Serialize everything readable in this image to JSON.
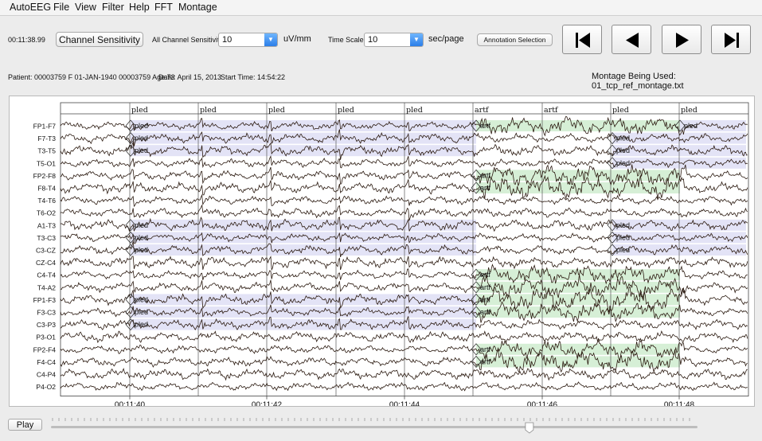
{
  "menu": [
    "AutoEEG",
    "File",
    "View",
    "Filter",
    "Help",
    "FFT",
    "Montage"
  ],
  "toolbar": {
    "clock": "00:11:38.99",
    "channel_sensitivity_button": "Channel Sensitivity",
    "all_channel_sensitivity_label": "All Channel Sensitivity",
    "sensitivity_value": "10",
    "sensitivity_unit": "uV/mm",
    "time_scale_label": "Time Scale",
    "time_scale_value": "10",
    "time_scale_unit": "sec/page",
    "annotation_button": "Annotation Selection",
    "nav_icons": [
      "skip-to-start-icon",
      "previous-icon",
      "next-icon",
      "skip-to-end-icon"
    ]
  },
  "info": {
    "patient": "Patient: 00003759 F 01-JAN-1940 00003759 Age:73",
    "date": "Date: April 15, 2013",
    "start_time": "Start Time: 14:54:22",
    "montage": "Montage Being Used: 01_tcp_ref_montage.txt"
  },
  "channels": [
    "FP1-F7",
    "F7-T3",
    "T3-T5",
    "T5-O1",
    "FP2-F8",
    "F8-T4",
    "T4-T6",
    "T6-O2",
    "A1-T3",
    "T3-C3",
    "C3-CZ",
    "CZ-C4",
    "C4-T4",
    "T4-A2",
    "FP1-F3",
    "F3-C3",
    "C3-P3",
    "P3-O1",
    "FP2-F4",
    "F4-C4",
    "C4-P4",
    "P4-O2"
  ],
  "time_labels": [
    "00:11:40",
    "00:11:42",
    "00:11:44",
    "00:11:46",
    "00:11:48"
  ],
  "top_markers": [
    "pled",
    "pled",
    "pled",
    "pled",
    "pled",
    "artf",
    "artf",
    "pled",
    "pled"
  ],
  "annotations": {
    "pled_label": "pled",
    "artf_label": "artf"
  },
  "colors": {
    "pled_band": "#e3e3f6",
    "artf_band": "#d6efd6",
    "trace": "#2b1a10"
  },
  "playback": {
    "play_label": "Play",
    "slider_position": 0.74
  }
}
